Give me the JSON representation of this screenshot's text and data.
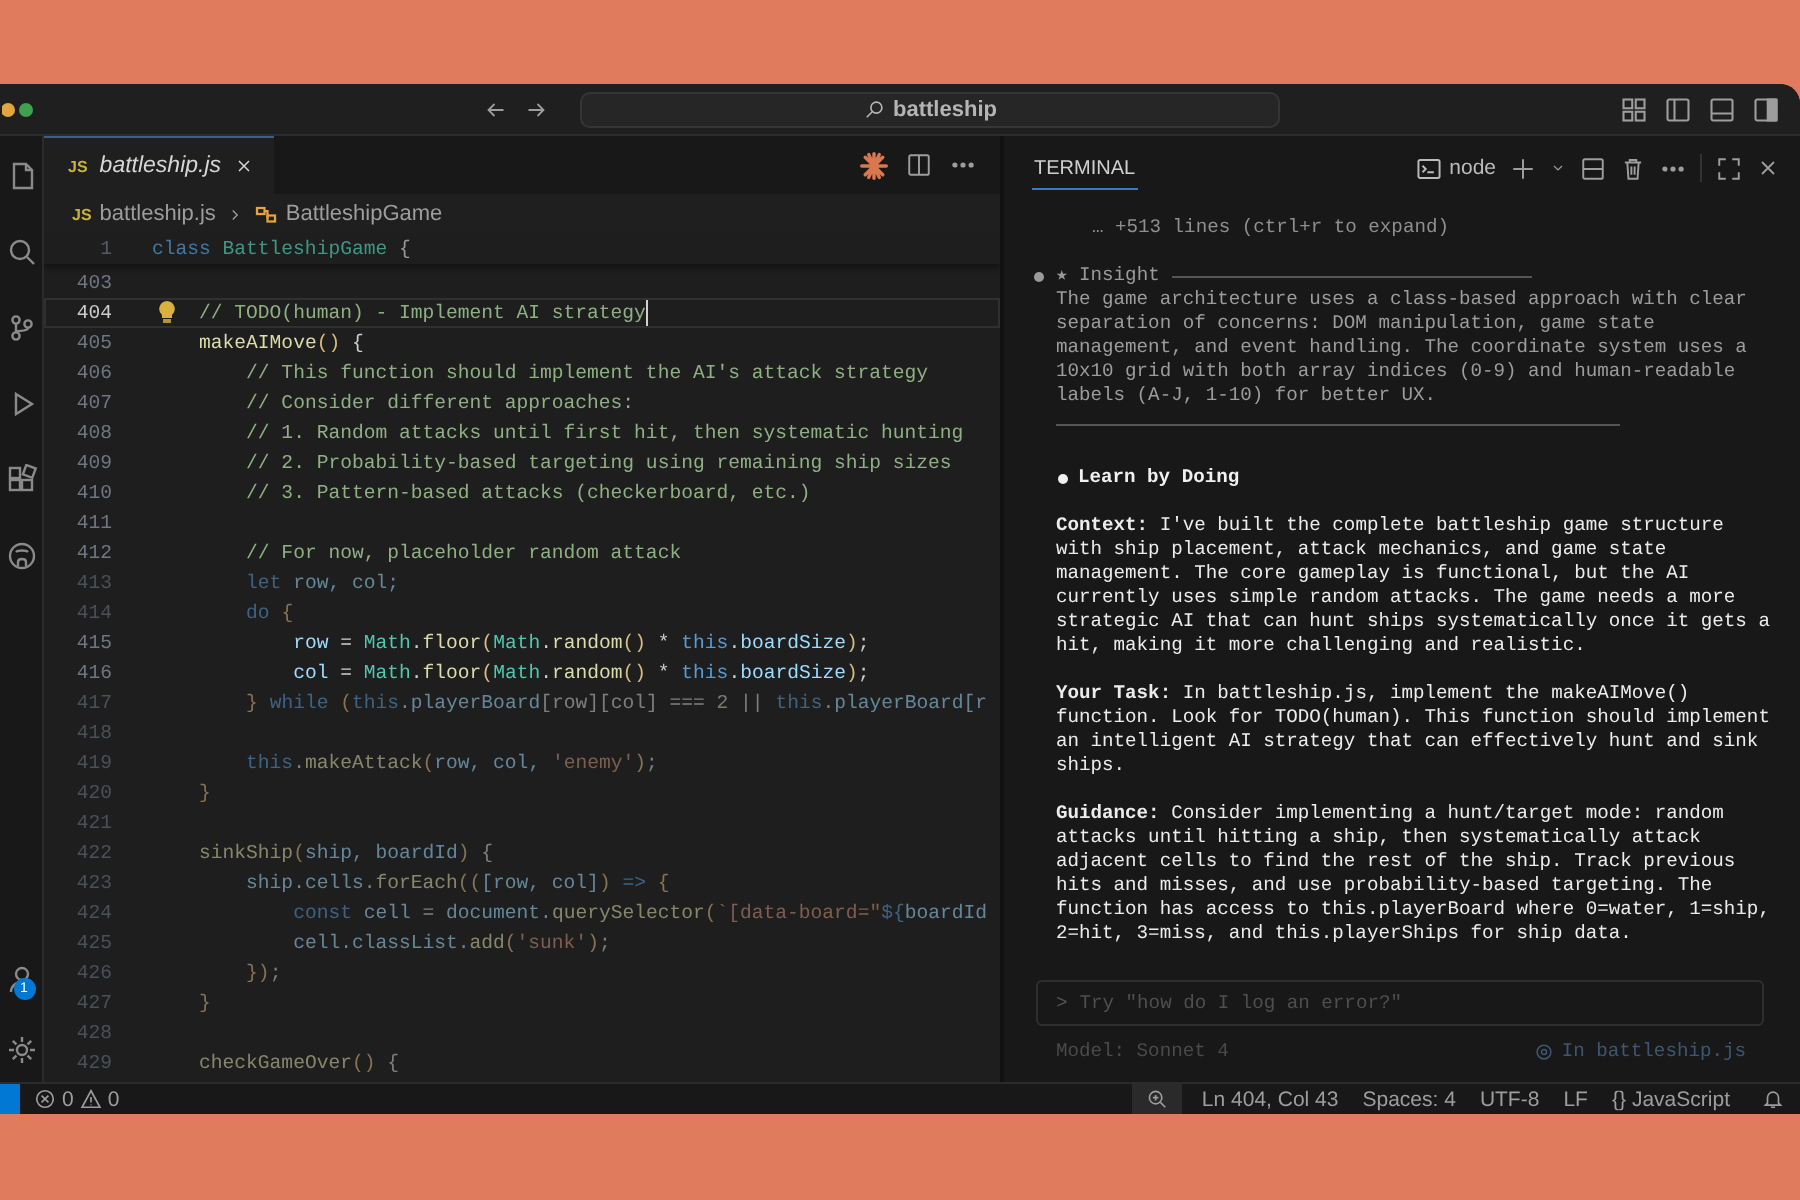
{
  "window": {
    "search": "battleship"
  },
  "activity_bar": {
    "account_badge": "1"
  },
  "editor": {
    "tabs": [
      {
        "icon_text": "JS",
        "label": "battleship.js",
        "selected": true,
        "preview": true
      }
    ],
    "breadcrumb": [
      {
        "kind": "file",
        "icon_text": "JS",
        "label": "battleship.js"
      },
      {
        "kind": "class",
        "label": "BattleshipGame"
      }
    ],
    "sticky_line": {
      "number": "1",
      "tokens": [
        {
          "kind": "kw",
          "text": "class "
        },
        {
          "kind": "cls",
          "text": "BattleshipGame"
        },
        {
          "kind": "pl",
          "text": " {"
        }
      ]
    },
    "lines": [
      {
        "number": "403",
        "current": false,
        "dimmed": false
      },
      {
        "number": "404",
        "current": true,
        "dimmed": false,
        "tokens": [
          {
            "kind": "cm",
            "text": "    // TODO(human) - Implement AI strategy"
          }
        ]
      },
      {
        "number": "405",
        "current": false,
        "dimmed": false,
        "tokens": [
          {
            "kind": "fn",
            "text": "    makeAIMove"
          },
          {
            "kind": "br",
            "text": "()"
          },
          {
            "kind": "pl",
            "text": " {"
          }
        ]
      },
      {
        "number": "406",
        "current": false,
        "dimmed": false,
        "tokens": [
          {
            "kind": "cm",
            "text": "        // This function should implement the AI's attack strategy"
          }
        ]
      },
      {
        "number": "407",
        "current": false,
        "dimmed": false,
        "tokens": [
          {
            "kind": "cm",
            "text": "        // Consider different approaches:"
          }
        ]
      },
      {
        "number": "408",
        "current": false,
        "dimmed": false,
        "tokens": [
          {
            "kind": "cm",
            "text": "        // 1. Random attacks until first hit, then systematic hunting"
          }
        ]
      },
      {
        "number": "409",
        "current": false,
        "dimmed": false,
        "tokens": [
          {
            "kind": "cm",
            "text": "        // 2. Probability-based targeting using remaining ship sizes"
          }
        ]
      },
      {
        "number": "410",
        "current": false,
        "dimmed": false,
        "tokens": [
          {
            "kind": "cm",
            "text": "        // 3. Pattern-based attacks (checkerboard, etc.)"
          }
        ]
      },
      {
        "number": "411",
        "current": false,
        "dimmed": false
      },
      {
        "number": "412",
        "current": false,
        "dimmed": false,
        "tokens": [
          {
            "kind": "cm",
            "text": "        // For now, placeholder random attack"
          }
        ]
      },
      {
        "number": "413",
        "current": false,
        "dimmed": true,
        "tokens": [
          {
            "kind": "kw",
            "text": "        let"
          },
          {
            "kind": "var",
            "text": " row, col;"
          }
        ]
      },
      {
        "number": "414",
        "current": false,
        "dimmed": true,
        "tokens": [
          {
            "kind": "kw",
            "text": "        do"
          },
          {
            "kind": "br",
            "text": " {"
          }
        ]
      },
      {
        "number": "415",
        "current": false,
        "dimmed": false,
        "tokens": [
          {
            "kind": "var",
            "text": "            row"
          },
          {
            "kind": "pl",
            "text": " = "
          },
          {
            "kind": "cls",
            "text": "Math"
          },
          {
            "kind": "pl",
            "text": "."
          },
          {
            "kind": "fn",
            "text": "floor"
          },
          {
            "kind": "br",
            "text": "("
          },
          {
            "kind": "cls",
            "text": "Math"
          },
          {
            "kind": "pl",
            "text": "."
          },
          {
            "kind": "fn",
            "text": "random"
          },
          {
            "kind": "br",
            "text": "()"
          },
          {
            "kind": "pl",
            "text": " * "
          },
          {
            "kind": "kw",
            "text": "this"
          },
          {
            "kind": "pl",
            "text": "."
          },
          {
            "kind": "var",
            "text": "boardSize"
          },
          {
            "kind": "br",
            "text": ")"
          },
          {
            "kind": "pl",
            "text": ";"
          }
        ]
      },
      {
        "number": "416",
        "current": false,
        "dimmed": false,
        "tokens": [
          {
            "kind": "var",
            "text": "            col"
          },
          {
            "kind": "pl",
            "text": " = "
          },
          {
            "kind": "cls",
            "text": "Math"
          },
          {
            "kind": "pl",
            "text": "."
          },
          {
            "kind": "fn",
            "text": "floor"
          },
          {
            "kind": "br",
            "text": "("
          },
          {
            "kind": "cls",
            "text": "Math"
          },
          {
            "kind": "pl",
            "text": "."
          },
          {
            "kind": "fn",
            "text": "random"
          },
          {
            "kind": "br",
            "text": "()"
          },
          {
            "kind": "pl",
            "text": " * "
          },
          {
            "kind": "kw",
            "text": "this"
          },
          {
            "kind": "pl",
            "text": "."
          },
          {
            "kind": "var",
            "text": "boardSize"
          },
          {
            "kind": "br",
            "text": ")"
          },
          {
            "kind": "pl",
            "text": ";"
          }
        ]
      },
      {
        "number": "417",
        "current": false,
        "dimmed": true,
        "tokens": [
          {
            "kind": "br",
            "text": "        }"
          },
          {
            "kind": "kw",
            "text": " while "
          },
          {
            "kind": "br",
            "text": "("
          },
          {
            "kind": "kw",
            "text": "this"
          },
          {
            "kind": "pl",
            "text": "."
          },
          {
            "kind": "var",
            "text": "playerBoard"
          },
          {
            "kind": "pl",
            "text": "[row][col] === "
          },
          {
            "kind": "num",
            "text": "2"
          },
          {
            "kind": "pl",
            "text": " || "
          },
          {
            "kind": "kw",
            "text": "this"
          },
          {
            "kind": "pl",
            "text": "."
          },
          {
            "kind": "var",
            "text": "playerBoard[r"
          }
        ]
      },
      {
        "number": "418",
        "current": false,
        "dimmed": true
      },
      {
        "number": "419",
        "current": false,
        "dimmed": true,
        "tokens": [
          {
            "kind": "kw",
            "text": "        this"
          },
          {
            "kind": "pl",
            "text": "."
          },
          {
            "kind": "fn",
            "text": "makeAttack"
          },
          {
            "kind": "br",
            "text": "("
          },
          {
            "kind": "var",
            "text": "row, col, "
          },
          {
            "kind": "str",
            "text": "'enemy'"
          },
          {
            "kind": "br",
            "text": ")"
          },
          {
            "kind": "pl",
            "text": ";"
          }
        ]
      },
      {
        "number": "420",
        "current": false,
        "dimmed": true,
        "tokens": [
          {
            "kind": "br",
            "text": "    }"
          }
        ]
      },
      {
        "number": "421",
        "current": false,
        "dimmed": true
      },
      {
        "number": "422",
        "current": false,
        "dimmed": true,
        "tokens": [
          {
            "kind": "fn",
            "text": "    sinkShip"
          },
          {
            "kind": "br",
            "text": "("
          },
          {
            "kind": "var",
            "text": "ship, boardId"
          },
          {
            "kind": "br",
            "text": ")"
          },
          {
            "kind": "pl",
            "text": " {"
          }
        ]
      },
      {
        "number": "423",
        "current": false,
        "dimmed": true,
        "tokens": [
          {
            "kind": "var",
            "text": "        ship.cells."
          },
          {
            "kind": "fn",
            "text": "forEach"
          },
          {
            "kind": "br",
            "text": "(("
          },
          {
            "kind": "var",
            "text": "[row, col]"
          },
          {
            "kind": "br",
            "text": ")"
          },
          {
            "kind": "kw",
            "text": " => "
          },
          {
            "kind": "br",
            "text": "{"
          }
        ]
      },
      {
        "number": "424",
        "current": false,
        "dimmed": true,
        "tokens": [
          {
            "kind": "kw",
            "text": "            const "
          },
          {
            "kind": "var",
            "text": "cell"
          },
          {
            "kind": "pl",
            "text": " = "
          },
          {
            "kind": "var",
            "text": "document."
          },
          {
            "kind": "fn",
            "text": "querySelector"
          },
          {
            "kind": "br",
            "text": "("
          },
          {
            "kind": "str",
            "text": "`[data-board=\""
          },
          {
            "kind": "kw",
            "text": "${"
          },
          {
            "kind": "var",
            "text": "boardId"
          }
        ]
      },
      {
        "number": "425",
        "current": false,
        "dimmed": true,
        "tokens": [
          {
            "kind": "var",
            "text": "            cell.classList."
          },
          {
            "kind": "fn",
            "text": "add"
          },
          {
            "kind": "br",
            "text": "("
          },
          {
            "kind": "str",
            "text": "'sunk'"
          },
          {
            "kind": "br",
            "text": ")"
          },
          {
            "kind": "pl",
            "text": ";"
          }
        ]
      },
      {
        "number": "426",
        "current": false,
        "dimmed": true,
        "tokens": [
          {
            "kind": "br",
            "text": "        })"
          },
          {
            "kind": "pl",
            "text": ";"
          }
        ]
      },
      {
        "number": "427",
        "current": false,
        "dimmed": true,
        "tokens": [
          {
            "kind": "br",
            "text": "    }"
          }
        ]
      },
      {
        "number": "428",
        "current": false,
        "dimmed": true
      },
      {
        "number": "429",
        "current": false,
        "dimmed": true,
        "tokens": [
          {
            "kind": "fn",
            "text": "    checkGameOver"
          },
          {
            "kind": "br",
            "text": "()"
          },
          {
            "kind": "pl",
            "text": " {"
          }
        ]
      }
    ]
  },
  "terminal": {
    "tabs": [
      {
        "label": "TERMINAL",
        "selected": true
      }
    ],
    "shell": "node",
    "collapsed_note": "… +513 lines (ctrl+r to expand)",
    "insight": {
      "title": "★ Insight",
      "text": "The game architecture uses a class-based approach with clear separation of concerns: DOM manipulation, game state management, and event handling. The coordinate system uses a 10x10 grid with both array indices (0-9) and human-readable labels (A-J, 1-10) for better UX."
    },
    "learn_title": "Learn by Doing",
    "paragraphs": [
      "**Context:** I've built the complete battleship game structure with ship placement, attack mechanics, and game state management. The core gameplay is functional, but the AI currently uses simple random attacks. The game needs a more strategic AI that can hunt ships systematically once it gets a hit, making it more challenging and realistic.",
      "**Your Task:** In battleship.js, implement the makeAIMove() function. Look for TODO(human). This function should implement an intelligent AI strategy that can effectively hunt and sink ships.",
      "**Guidance:** Consider implementing a hunt/target mode: random attacks until hitting a ship, then systematically attack adjacent cells to find the rest of the ship. Track previous hits and misses, and use probability-based targeting. The function has access to this.playerBoard where 0=water, 1=ship, 2=hit, 3=miss, and this.playerShips for ship data."
    ],
    "input": {
      "prompt": ">",
      "placeholder": "Try \"how do I log an error?\""
    },
    "model": "Model: Sonnet 4",
    "context_file": "In battleship.js"
  },
  "status_bar": {
    "errors": "0",
    "warnings": "0",
    "items": [
      {
        "kind": "zoom"
      },
      {
        "kind": "text",
        "text": "Ln 404, Col 43"
      },
      {
        "kind": "text",
        "text": "Spaces: 4"
      },
      {
        "kind": "text",
        "text": "UTF-8"
      },
      {
        "kind": "text",
        "text": "LF"
      },
      {
        "kind": "language",
        "icon_text": "{}",
        "text": "JavaScript"
      },
      {
        "kind": "bell"
      }
    ]
  }
}
